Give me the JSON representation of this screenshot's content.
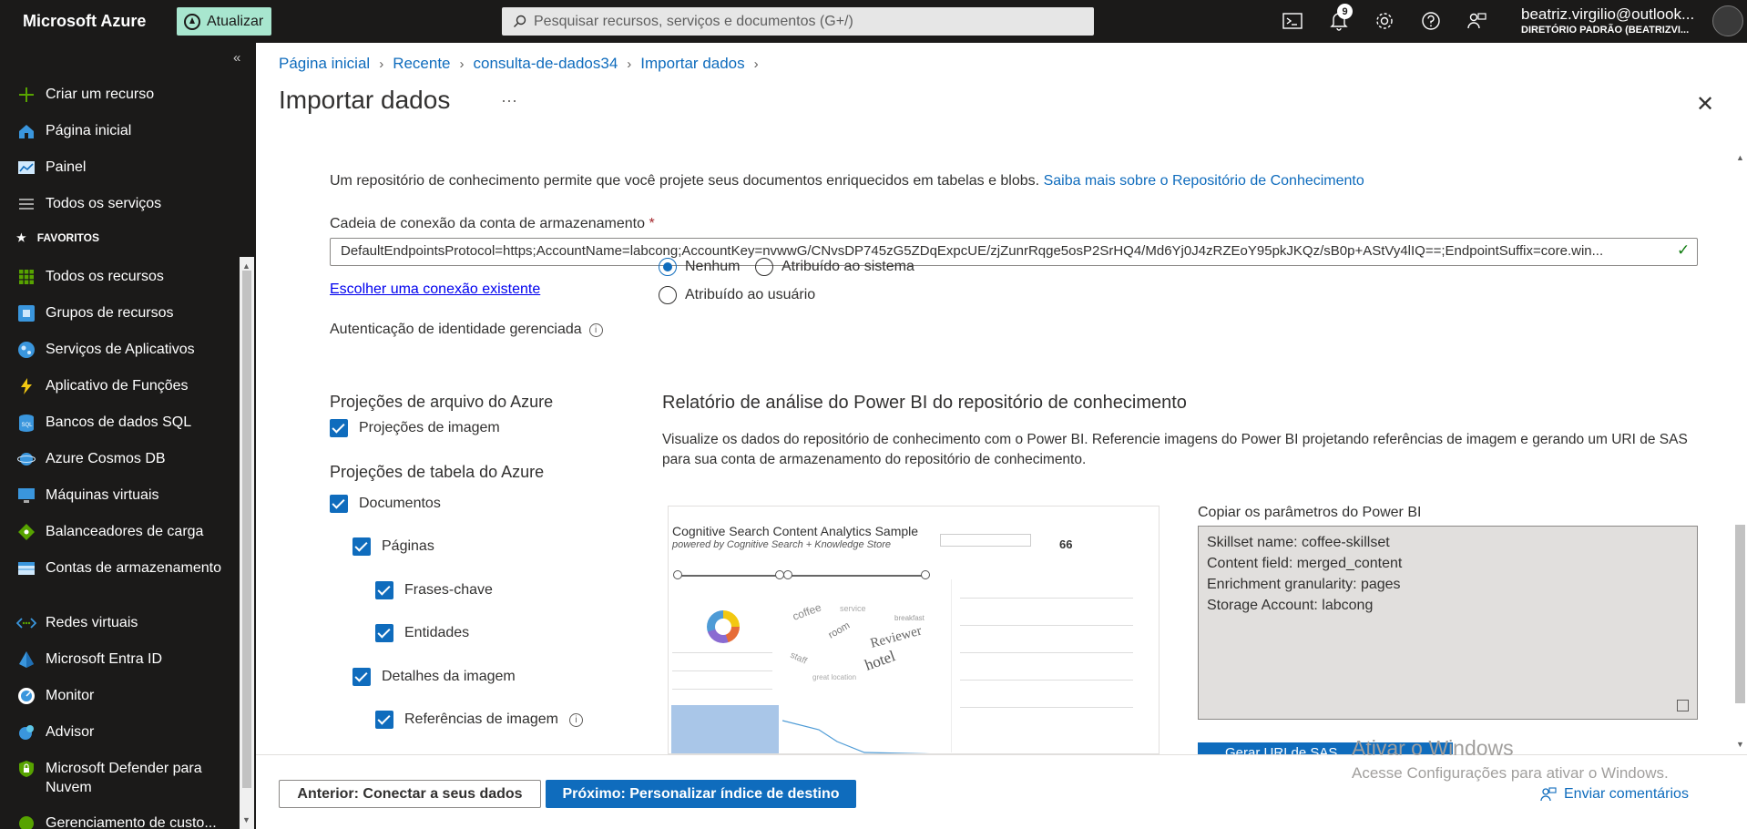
{
  "topbar": {
    "brand": "Microsoft Azure",
    "upgrade_label": "Atualizar",
    "search_placeholder": "Pesquisar recursos, serviços e documentos (G+/)",
    "notification_count": "9",
    "account_email": "beatriz.virgilio@outlook...",
    "account_directory": "DIRETÓRIO PADRÃO (BEATRIZVI..."
  },
  "sidebar": {
    "items_top": [
      {
        "label": "Criar um recurso",
        "icon": "plus-icon"
      },
      {
        "label": "Página inicial",
        "icon": "home-icon"
      },
      {
        "label": "Painel",
        "icon": "dashboard-icon"
      },
      {
        "label": "Todos os serviços",
        "icon": "list-icon"
      }
    ],
    "favorites_label": "FAVORITOS",
    "items_fav": [
      {
        "label": "Todos os recursos",
        "icon": "grid-icon"
      },
      {
        "label": "Grupos de recursos",
        "icon": "resource-group-icon"
      },
      {
        "label": "Serviços de Aplicativos",
        "icon": "app-service-icon"
      },
      {
        "label": "Aplicativo de Funções",
        "icon": "function-icon"
      },
      {
        "label": "Bancos de dados SQL",
        "icon": "sql-icon"
      },
      {
        "label": "Azure Cosmos DB",
        "icon": "cosmos-icon"
      },
      {
        "label": "Máquinas virtuais",
        "icon": "vm-icon"
      },
      {
        "label": "Balanceadores de carga",
        "icon": "load-balancer-icon"
      },
      {
        "label": "Contas de armazenamento",
        "icon": "storage-icon"
      },
      {
        "label": "Redes virtuais",
        "icon": "vnet-icon"
      },
      {
        "label": "Microsoft Entra ID",
        "icon": "entra-icon"
      },
      {
        "label": "Monitor",
        "icon": "monitor-icon"
      },
      {
        "label": "Advisor",
        "icon": "advisor-icon"
      },
      {
        "label": "Microsoft Defender para Nuvem",
        "icon": "defender-icon"
      },
      {
        "label": "Gerenciamento de custo...",
        "icon": "cost-icon"
      }
    ]
  },
  "breadcrumb": [
    "Página inicial",
    "Recente",
    "consulta-de-dados34",
    "Importar dados"
  ],
  "page_title": "Importar dados",
  "form": {
    "description": "Um repositório de conhecimento permite que você projete seus documentos enriquecidos em tabelas e blobs.",
    "learn_more": "Saiba mais sobre o Repositório de Conhecimento",
    "conn_label": "Cadeia de conexão da conta de armazenamento",
    "required_mark": "*",
    "conn_value": "DefaultEndpointsProtocol=https;AccountName=labcong;AccountKey=nvwwG/CNvsDP745zG5ZDqExpcUE/zjZunrRqge5osP2SrHQ4/Md6Yj0J4zRZEoY95pkJKQz/sB0p+AStVy4lIQ==;EndpointSuffix=core.win...",
    "choose_link": "Escolher uma conexão existente",
    "auth_label": "Autenticação de identidade gerenciada",
    "radio_none": "Nenhum",
    "radio_system": "Atribuído ao sistema",
    "radio_user": "Atribuído ao usuário",
    "selected_auth": "Nenhum"
  },
  "projections": {
    "file_title": "Projeções de arquivo do Azure",
    "image_projections": "Projeções de imagem",
    "table_title": "Projeções de tabela do Azure",
    "documents": "Documentos",
    "pages": "Páginas",
    "key_phrases": "Frases-chave",
    "entities": "Entidades",
    "image_details": "Detalhes da imagem",
    "image_references": "Referências de imagem"
  },
  "powerbi": {
    "title": "Relatório de análise do Power BI do repositório de conhecimento",
    "description": "Visualize os dados do repositório de conhecimento com o Power BI. Referencie imagens do Power BI projetando referências de imagem e gerando um URI de SAS para sua conta de armazenamento do repositório de conhecimento.",
    "report_title": "Cognitive Search Content Analytics Sample",
    "report_subtitle": "powered by Cognitive Search + Knowledge Store",
    "report_count": "66",
    "copy_label": "Copiar os parâmetros do Power BI",
    "params": [
      "Skillset name: coffee-skillset",
      "Content field: merged_content",
      "Enrichment granularity: pages",
      "Storage Account: labcong"
    ],
    "generate_button": "Gerar URI de SAS"
  },
  "watermark": {
    "line1": "Ativar o Windows",
    "line2": "Acesse Configurações para ativar o Windows."
  },
  "footer": {
    "prev_button": "Anterior: Conectar a seus dados",
    "next_button": "Próximo: Personalizar índice de destino",
    "feedback": "Enviar comentários"
  },
  "colors": {
    "accent": "#0f6cbd",
    "topbar": "#1b1a19",
    "upgrade": "#a8e6cf"
  }
}
